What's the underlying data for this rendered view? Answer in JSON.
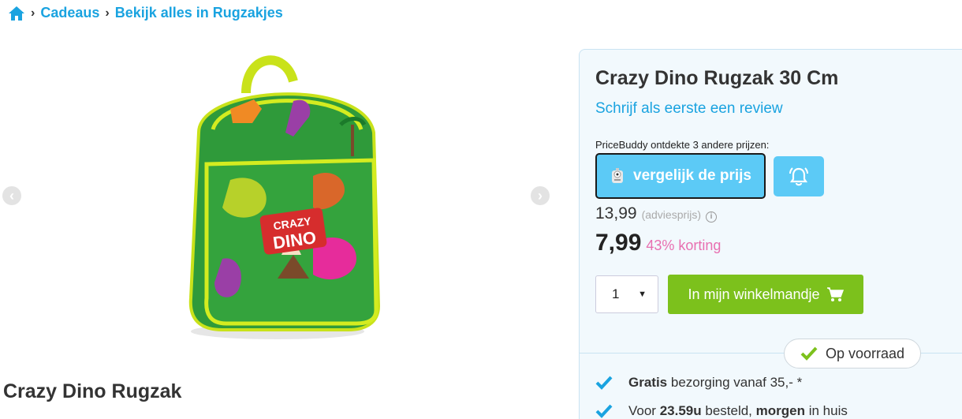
{
  "breadcrumb": {
    "home_icon": "home-icon",
    "items": [
      {
        "label": "Cadeaus"
      },
      {
        "label": "Bekijk alles in Rugzakjes"
      }
    ],
    "separator": "›"
  },
  "gallery": {
    "prev_icon": "chevron-left-icon",
    "next_icon": "chevron-right-icon",
    "prev_symbol": "‹",
    "next_symbol": "›",
    "image_alt": "Crazy Dino Rugzak",
    "image_logo_text_1": "CRAZY",
    "image_logo_text_2": "DINO"
  },
  "product": {
    "name_bottom": "Crazy Dino Rugzak",
    "title": "Crazy Dino Rugzak 30 Cm",
    "review_link": "Schrijf als eerste een review",
    "pricebuddy_text": "PriceBuddy ontdekte 3 andere prijzen:",
    "compare_label": "vergelijk de prijs",
    "old_price": "13,99",
    "advies_label": "(adviesprijs)",
    "info_symbol": "i",
    "new_price": "7,99",
    "discount": "43% korting",
    "quantity": "1",
    "caret": "▼",
    "cart_label": "In mijn winkelmandje",
    "stock": "Op voorraad"
  },
  "usps": [
    {
      "bold": "Gratis",
      "text": " bezorging vanaf 35,- *"
    },
    {
      "pre": "Voor ",
      "bold": "23.59u",
      "mid": " besteld, ",
      "bold2": "morgen",
      "post": " in huis"
    }
  ],
  "colors": {
    "link": "#1aa3e0",
    "pricebuddy": "#5ccaf6",
    "cart": "#7cc11c",
    "discount": "#e86fb0",
    "check": "#1aa3e0",
    "stock_check": "#7cc11c"
  }
}
